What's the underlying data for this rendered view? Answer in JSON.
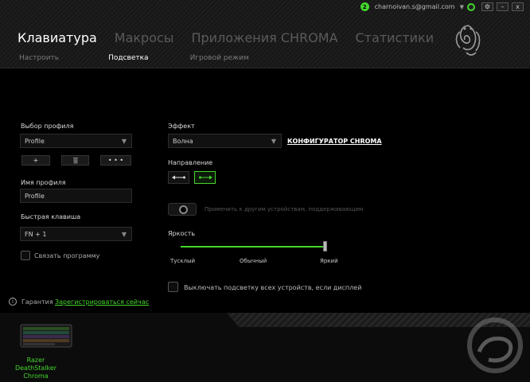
{
  "window": {
    "notification_count": "2",
    "email": "charnoivan.s@gmail.com",
    "settings_glyph": "⚙",
    "minimize_glyph": "–",
    "close_glyph": "x"
  },
  "main_tabs": [
    {
      "label": "Клавиатура",
      "active": true
    },
    {
      "label": "Макросы",
      "active": false
    },
    {
      "label": "Приложения CHROMA",
      "active": false
    },
    {
      "label": "Статистики",
      "active": false
    }
  ],
  "sub_tabs": [
    {
      "label": "Настроить",
      "active": false
    },
    {
      "label": "Подсветка",
      "active": true
    },
    {
      "label": "Игровой режим",
      "active": false
    }
  ],
  "profile": {
    "section_label": "Выбор профиля",
    "selected": "Profile",
    "add_label": "+",
    "delete_icon": "trash-icon",
    "more_label": "• • •",
    "name_label": "Имя профиля",
    "name_value": "Profile",
    "hotkey_label": "Быстрая клавиша",
    "hotkey_value": "FN + 1",
    "link_program_label": "Связать программу"
  },
  "effect": {
    "label": "Эффект",
    "selected": "Волна",
    "configurator_link": "КОНФИГУРАТОР CHROMA",
    "direction_label": "Направление",
    "apply_text": "Применить к другим устройствам, поддерживающим",
    "brightness_label": "Яркость",
    "brightness_level": 1.0,
    "brightness_ticks": [
      "Тусклый",
      "Обычный",
      "Яркий"
    ],
    "display_off_text": "Выключать подсветку всех устройств, если дисплей"
  },
  "warranty": {
    "label": "Гарантия",
    "register_link": "Зарегистрироваться сейчас"
  },
  "device": {
    "name": "Razer DeathStalker Chroma"
  },
  "colors": {
    "accent": "#44d62c"
  }
}
